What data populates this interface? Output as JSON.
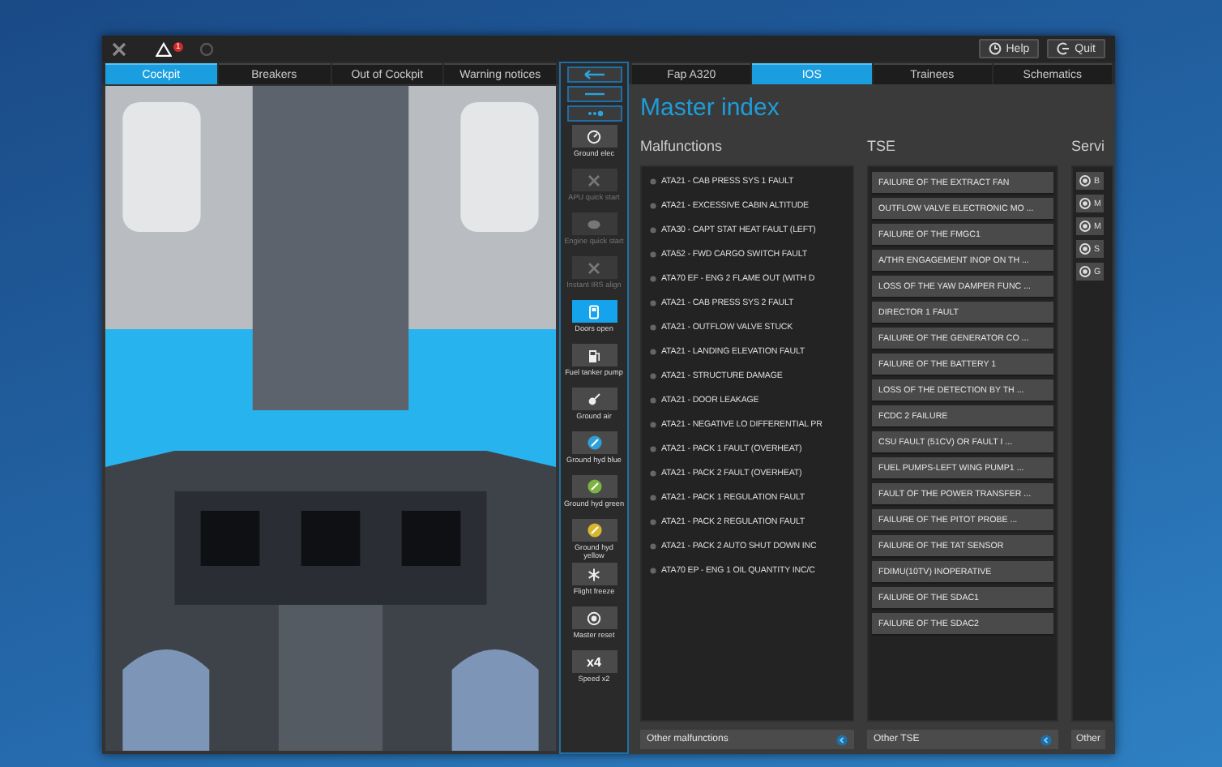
{
  "top_bar": {
    "alert_count": "1",
    "buttons": [
      {
        "kind": "help",
        "label": "Help"
      },
      {
        "kind": "quit",
        "label": "Quit"
      }
    ]
  },
  "left_tabs": [
    {
      "label": "Cockpit",
      "selected": true
    },
    {
      "label": "Breakers",
      "selected": false
    },
    {
      "label": "Out of Cockpit",
      "selected": false
    },
    {
      "label": "Warning notices",
      "selected": false
    }
  ],
  "toolbar": [
    {
      "kind": "gauge",
      "label": "Ground elec",
      "disabled": false,
      "selected": false
    },
    {
      "kind": "fan",
      "label": "APU quick start",
      "disabled": true,
      "selected": false
    },
    {
      "kind": "engine",
      "label": "Engine quick start",
      "disabled": true,
      "selected": false
    },
    {
      "kind": "fan",
      "label": "Instant IRS align",
      "disabled": true,
      "selected": false
    },
    {
      "kind": "door",
      "label": "Doors open",
      "disabled": false,
      "selected": true
    },
    {
      "kind": "fuel",
      "label": "Fuel tanker pump",
      "disabled": false,
      "selected": false
    },
    {
      "kind": "air",
      "label": "Ground air",
      "disabled": false,
      "selected": false
    },
    {
      "kind": "hyd",
      "label": "Ground hyd blue",
      "color": "#2f9fd8",
      "disabled": false,
      "selected": false
    },
    {
      "kind": "hyd",
      "label": "Ground hyd green",
      "color": "#7cb342",
      "disabled": false,
      "selected": false
    },
    {
      "kind": "hyd",
      "label": "Ground hyd yellow",
      "color": "#d8b630",
      "disabled": false,
      "selected": false
    },
    {
      "kind": "snow",
      "label": "Flight freeze",
      "disabled": false,
      "selected": false
    },
    {
      "kind": "reset",
      "label": "Master reset",
      "disabled": false,
      "selected": false
    },
    {
      "kind": "speed",
      "value": "x4",
      "label": "Speed x2",
      "disabled": false,
      "selected": false
    }
  ],
  "right_tabs": [
    {
      "label": "Fap A320",
      "selected": false
    },
    {
      "label": "IOS",
      "selected": true
    },
    {
      "label": "Trainees",
      "selected": false
    },
    {
      "label": "Schematics",
      "selected": false
    }
  ],
  "page_title": "Master index",
  "malfunctions": {
    "heading": "Malfunctions",
    "items": [
      "ATA21 - CAB PRESS SYS 1 FAULT",
      "ATA21 - EXCESSIVE CABIN ALTITUDE",
      "ATA30 - CAPT STAT HEAT FAULT (LEFT)",
      "ATA52 - FWD CARGO SWITCH FAULT",
      "ATA70 EF - ENG 2 FLAME OUT (WITH D",
      "ATA21 - CAB PRESS SYS 2 FAULT",
      "ATA21 - OUTFLOW VALVE STUCK",
      "ATA21 - LANDING ELEVATION FAULT",
      "ATA21 - STRUCTURE DAMAGE",
      "ATA21 - DOOR LEAKAGE",
      "ATA21 - NEGATIVE LO DIFFERENTIAL PR",
      "ATA21 - PACK 1 FAULT (OVERHEAT)",
      "ATA21 - PACK 2 FAULT (OVERHEAT)",
      "ATA21 - PACK 1 REGULATION FAULT",
      "ATA21 - PACK 2 REGULATION FAULT",
      "ATA21 - PACK 2 AUTO SHUT DOWN INC",
      "ATA70 EP - ENG 1 OIL QUANTITY INC/C"
    ],
    "dropdown": "Other malfunctions"
  },
  "tse": {
    "heading": "TSE",
    "items": [
      "FAILURE OF THE EXTRACT FAN",
      "OUTFLOW VALVE ELECTRONIC MO ...",
      "FAILURE OF THE FMGC1",
      "A/THR ENGAGEMENT INOP ON TH ...",
      "LOSS OF THE YAW DAMPER FUNC ...",
      "DIRECTOR 1 FAULT",
      "FAILURE OF THE GENERATOR CO ...",
      "FAILURE OF THE BATTERY 1",
      "LOSS OF THE DETECTION BY TH ...",
      "FCDC 2 FAILURE",
      "CSU FAULT (51CV) OR FAULT I ...",
      "FUEL PUMPS-LEFT WING PUMP1 ...",
      "FAULT OF THE POWER TRANSFER ...",
      "FAILURE OF THE PITOT PROBE ...",
      "FAILURE OF THE TAT SENSOR",
      "FDIMU(10TV) INOPERATIVE",
      "FAILURE OF THE SDAC1",
      "FAILURE OF THE SDAC2"
    ],
    "dropdown": "Other TSE"
  },
  "services": {
    "heading": "Servi",
    "items": [
      "B",
      "M",
      "M",
      "S",
      "G"
    ],
    "dropdown": "Other"
  }
}
